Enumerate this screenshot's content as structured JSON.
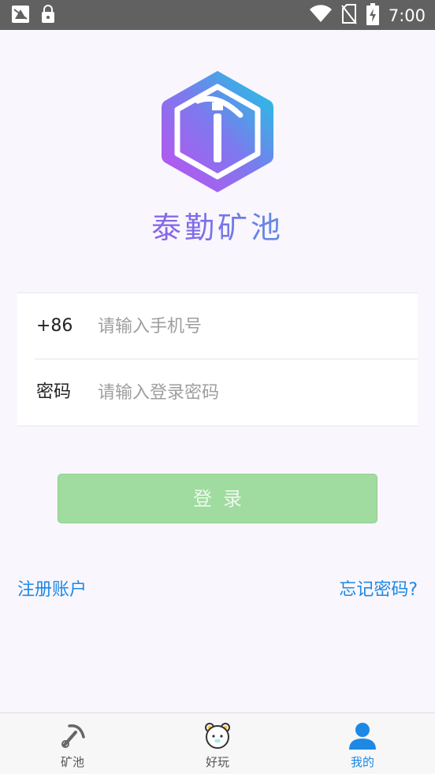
{
  "status_bar": {
    "time": "7:00",
    "icons": [
      "notification-icon",
      "lock-icon",
      "wifi-icon",
      "no-sim-icon",
      "battery-charging-icon"
    ]
  },
  "app": {
    "name": "泰勤矿池",
    "logo_icon": "pickaxe-hexagon-logo"
  },
  "login_form": {
    "phone_prefix": "+86",
    "phone_placeholder": "请输入手机号",
    "password_label": "密码",
    "password_placeholder": "请输入登录密码",
    "login_button": "登录"
  },
  "links": {
    "register": "注册账户",
    "forgot_password": "忘记密码?"
  },
  "bottom_nav": {
    "items": [
      {
        "label": "矿池",
        "icon": "pickaxe-icon",
        "active": false
      },
      {
        "label": "好玩",
        "icon": "bear-face-icon",
        "active": false
      },
      {
        "label": "我的",
        "icon": "user-icon",
        "active": true
      }
    ]
  },
  "colors": {
    "accent": "#1e88e5",
    "login_button": "#a0dba0",
    "status_bar": "#616161"
  }
}
